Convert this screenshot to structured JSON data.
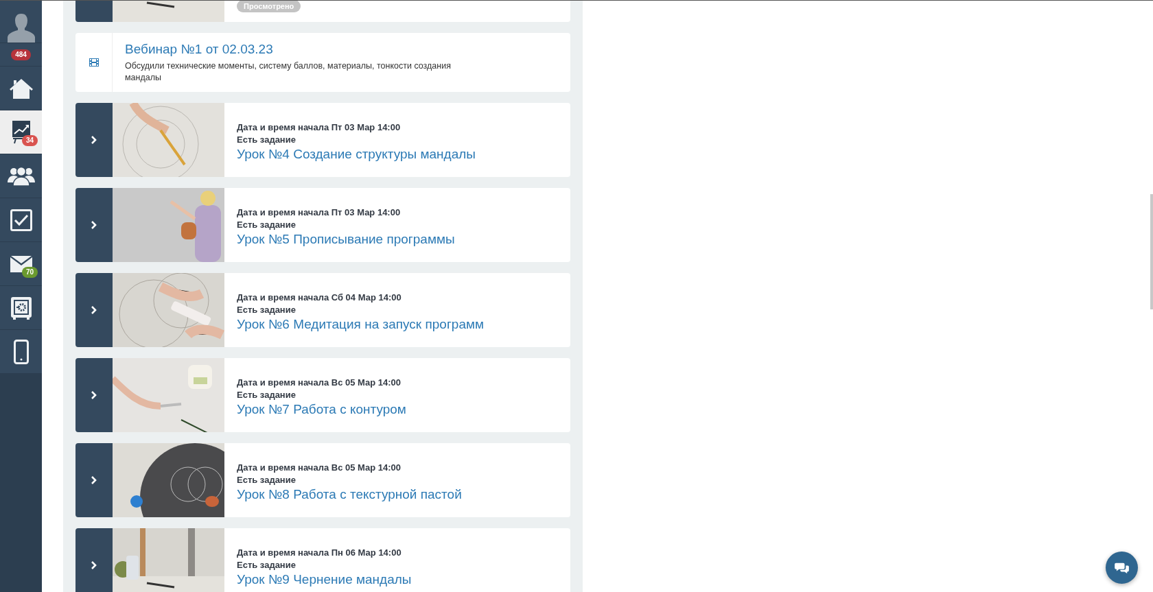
{
  "sidebar": {
    "items": [
      {
        "kind": "avatar",
        "selected": false
      },
      {
        "kind": "counter",
        "badge": "484",
        "color": "#b7333b",
        "selected": false
      },
      {
        "kind": "home",
        "selected": false
      },
      {
        "kind": "chart",
        "badge": "34",
        "color": "#d9534f",
        "selected": true
      },
      {
        "kind": "people",
        "selected": false
      },
      {
        "kind": "checkbox",
        "selected": false
      },
      {
        "kind": "mail",
        "badge": "70",
        "color": "#6b9a2f",
        "selected": false
      },
      {
        "kind": "safe",
        "selected": false
      },
      {
        "kind": "phone",
        "selected": false
      }
    ]
  },
  "lessons": [
    {
      "kind": "viewed",
      "status": "Просмотрено"
    },
    {
      "kind": "webinar",
      "title": "Вебинар №1 от 02.03.23",
      "description": "Обсудили технические моменты, систему баллов, материалы, тонкости создания мандалы"
    },
    {
      "kind": "lesson",
      "start": "Дата и время начала Пт 03 Мар 14:00",
      "task": "Есть задание",
      "title": "Урок №4 Создание структуры мандалы"
    },
    {
      "kind": "lesson",
      "start": "Дата и время начала Пт 03 Мар 14:00",
      "task": "Есть задание",
      "title": "Урок №5 Прописывание программы"
    },
    {
      "kind": "lesson",
      "start": "Дата и время начала Сб 04 Мар 14:00",
      "task": "Есть задание",
      "title": "Урок №6 Медитация на запуск программ"
    },
    {
      "kind": "lesson",
      "start": "Дата и время начала Вс 05 Мар 14:00",
      "task": "Есть задание",
      "title": "Урок №7 Работа с контуром"
    },
    {
      "kind": "lesson",
      "start": "Дата и время начала Вс 05 Мар 14:00",
      "task": "Есть задание",
      "title": "Урок №8 Работа с текстурной пастой"
    },
    {
      "kind": "lesson",
      "start": "Дата и время начала Пн 06 Мар 14:00",
      "task": "Есть задание",
      "title": "Урок №9 Чернение мандалы"
    }
  ]
}
